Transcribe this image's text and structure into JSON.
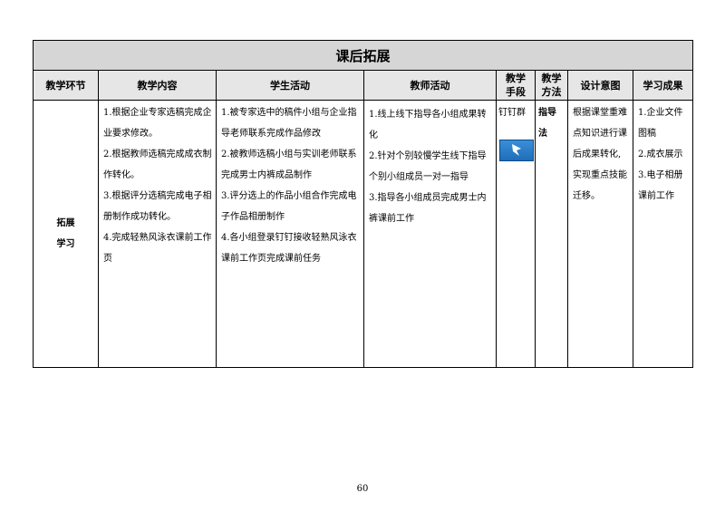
{
  "table": {
    "title": "课后拓展",
    "headers": [
      "教学环节",
      "教学内容",
      "学生活动",
      "教师活动",
      "教学\n手段",
      "教学\n方法",
      "设计意图",
      "学习成果"
    ],
    "stage": [
      "拓展",
      "学习"
    ],
    "content": [
      "1.根据企业专家选稿完成企业要求修改。",
      "2.根据教师选稿完成成衣制作转化。",
      "3.根据评分选稿完成电子相册制作成功转化。",
      "4.完成轻熟风泳衣课前工作页"
    ],
    "student": [
      "1.被专家选中的稿件小组与企业指导老师联系完成作品修改",
      "2.被教师选稿小组与实训老师联系完成男士内裤成品制作",
      "3.评分选上的作品小组合作完成电子作品相册制作",
      "4.各小组登录钉钉接收轻熟风泳衣课前工作页完成课前任务"
    ],
    "teacher": [
      "1.线上线下指导各小组成果转化",
      "2.针对个别较慢学生线下指导个别小组成员一对一指导",
      "3.指导各小组成员完成男士内裤课前工作"
    ],
    "means": "钉钉群",
    "means_icon": "dingtalk-app-icon",
    "method": "指导法",
    "intent": "根据课堂重难点知识进行课后成果转化,实现重点技能迁移。",
    "outcomes": [
      "1.企业文件图稿",
      "2.成衣展示",
      "3.电子相册课前工作"
    ]
  },
  "page_number": "60"
}
